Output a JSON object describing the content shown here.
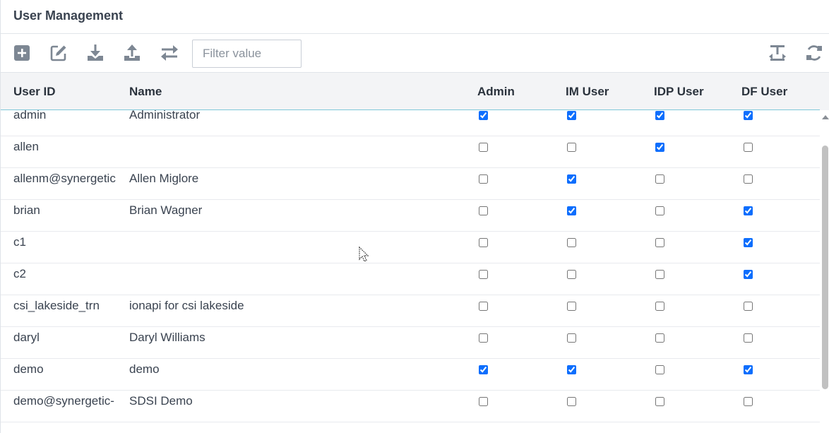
{
  "panel": {
    "title": "User Management"
  },
  "toolbar": {
    "buttons": [
      {
        "name": "add-icon"
      },
      {
        "name": "edit-icon"
      },
      {
        "name": "download-icon"
      },
      {
        "name": "upload-icon"
      },
      {
        "name": "transfer-icon"
      }
    ],
    "filter_placeholder": "Filter value",
    "right_buttons": [
      {
        "name": "text-height-icon"
      },
      {
        "name": "refresh-icon"
      }
    ],
    "icon_color": "#7d8793"
  },
  "table": {
    "columns": [
      "User ID",
      "Name",
      "Admin",
      "IM User",
      "IDP User",
      "DF User"
    ],
    "rows": [
      {
        "user_id": "admin",
        "name": "Administrator",
        "admin": true,
        "im_user": true,
        "idp_user": true,
        "df_user": true
      },
      {
        "user_id": "allen",
        "name": "",
        "admin": false,
        "im_user": false,
        "idp_user": true,
        "df_user": false
      },
      {
        "user_id": "allenm@synergetic",
        "name": "Allen Miglore",
        "admin": false,
        "im_user": true,
        "idp_user": false,
        "df_user": false
      },
      {
        "user_id": "brian",
        "name": "Brian Wagner",
        "admin": false,
        "im_user": true,
        "idp_user": false,
        "df_user": true
      },
      {
        "user_id": "c1",
        "name": "",
        "admin": false,
        "im_user": false,
        "idp_user": false,
        "df_user": true
      },
      {
        "user_id": "c2",
        "name": "",
        "admin": false,
        "im_user": false,
        "idp_user": false,
        "df_user": true
      },
      {
        "user_id": "csi_lakeside_trn",
        "name": "ionapi for csi lakeside",
        "admin": false,
        "im_user": false,
        "idp_user": false,
        "df_user": false
      },
      {
        "user_id": "daryl",
        "name": "Daryl Williams",
        "admin": false,
        "im_user": false,
        "idp_user": false,
        "df_user": false
      },
      {
        "user_id": "demo",
        "name": "demo",
        "admin": true,
        "im_user": true,
        "idp_user": false,
        "df_user": true
      },
      {
        "user_id": "demo@synergetic-",
        "name": "SDSI Demo",
        "admin": false,
        "im_user": false,
        "idp_user": false,
        "df_user": false
      }
    ]
  }
}
